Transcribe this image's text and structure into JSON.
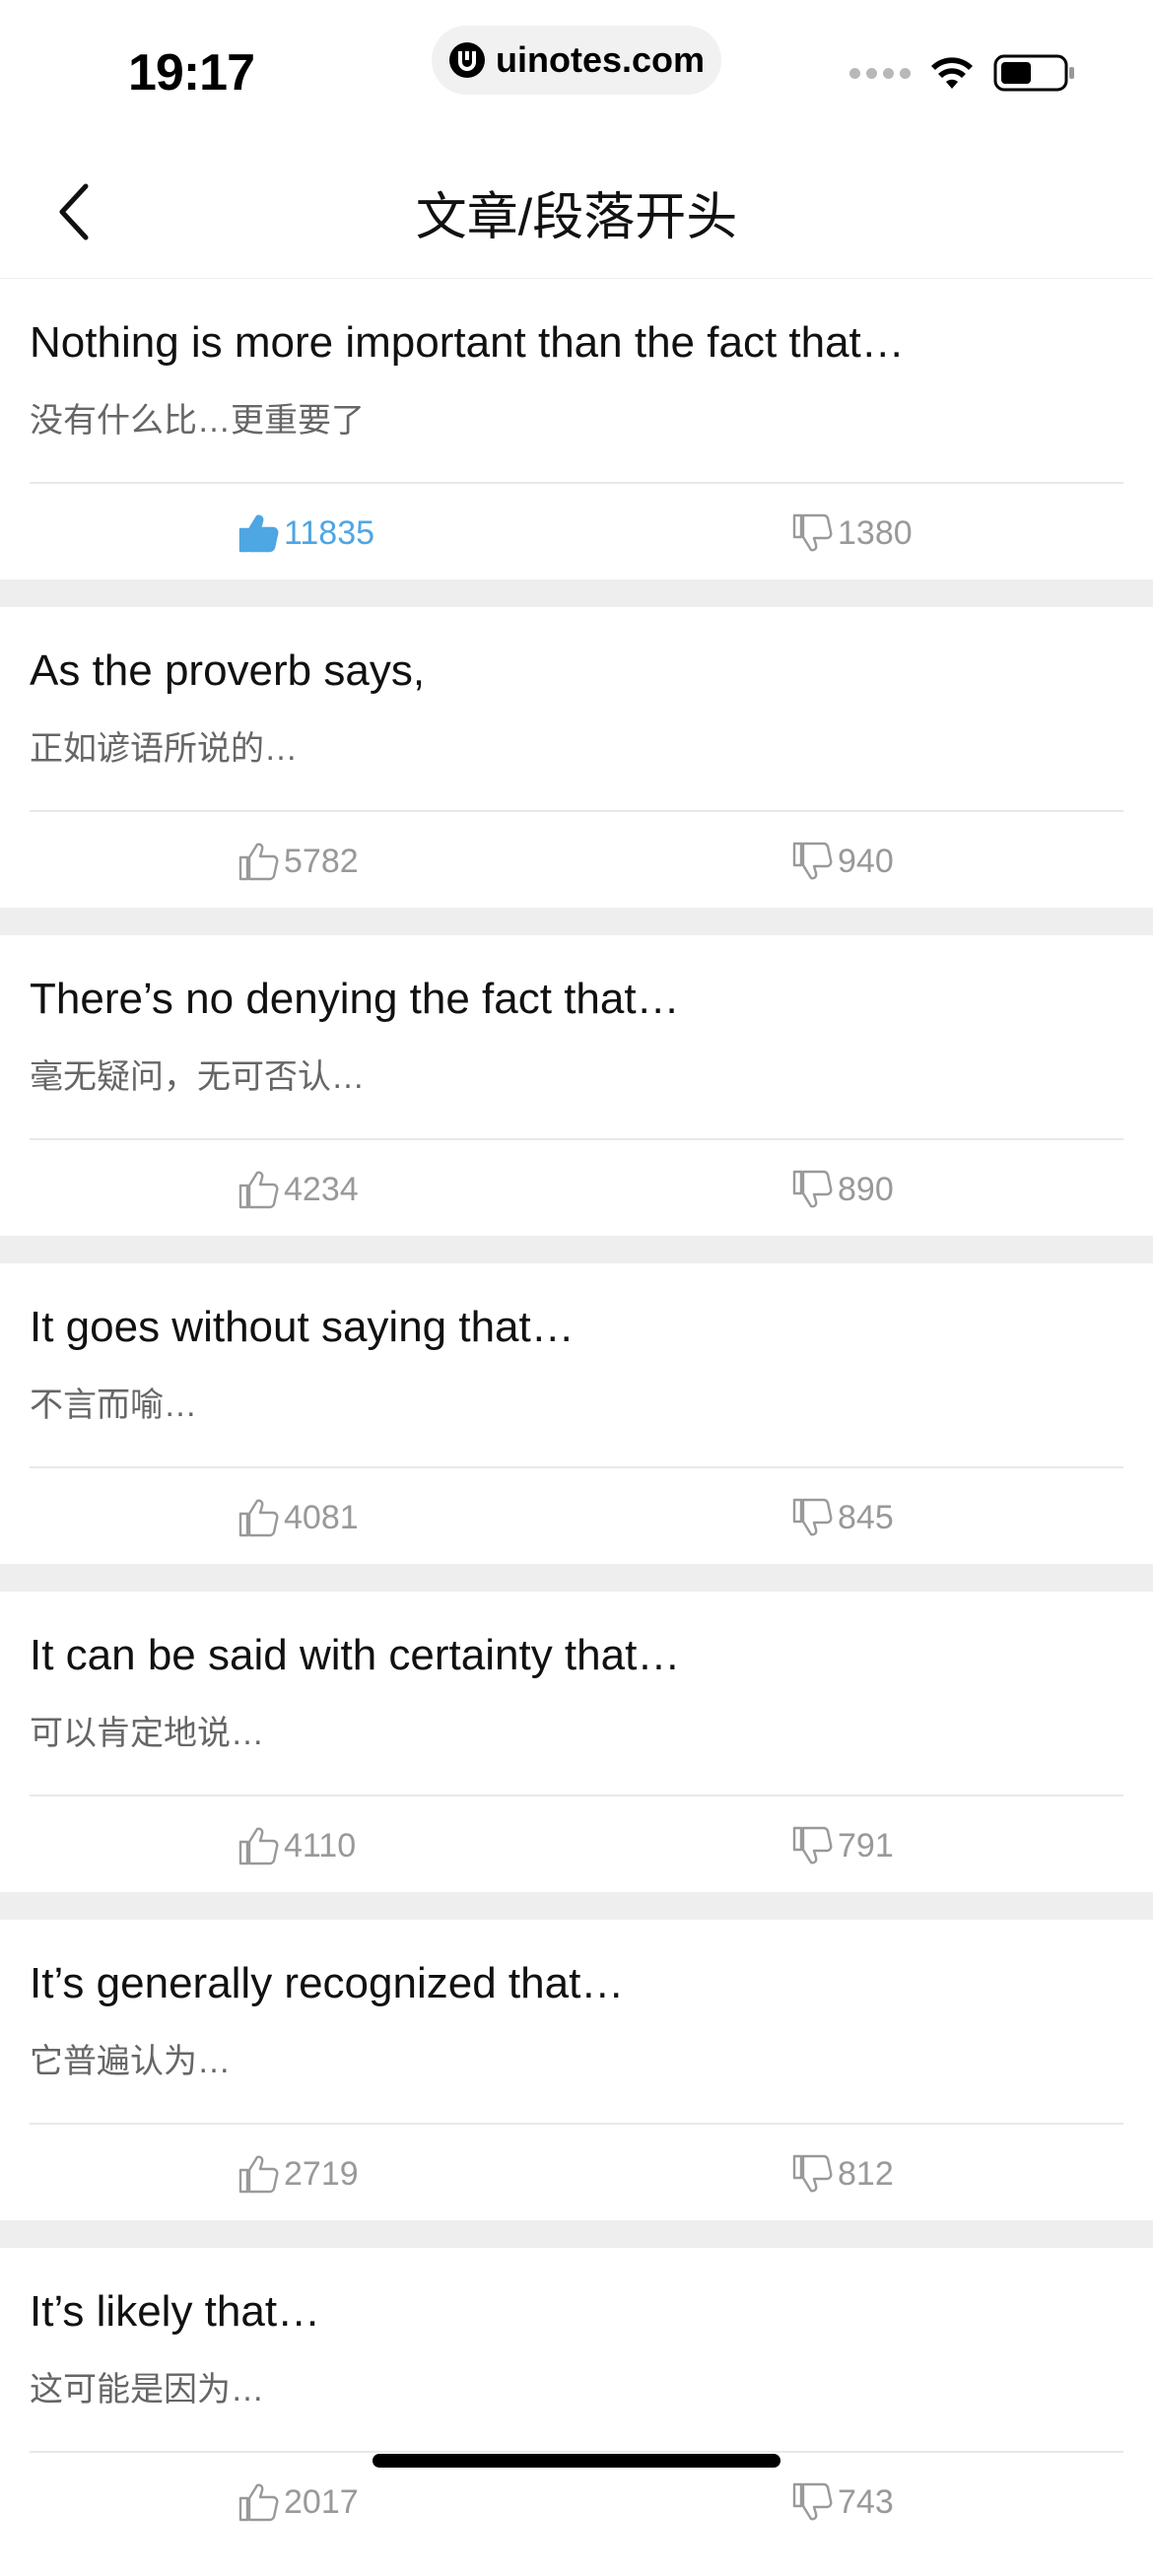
{
  "status_bar": {
    "time": "19:17",
    "url": "uinotes.com"
  },
  "nav": {
    "title": "文章/段落开头",
    "back_icon": "chevron-left-icon"
  },
  "icons": {
    "like": "thumbs-up-icon",
    "dislike": "thumbs-down-icon"
  },
  "colors": {
    "accent": "#4ea6e3",
    "muted": "#999999",
    "separator": "#eeeeee"
  },
  "items": [
    {
      "english": "Nothing is more important than the fact that…",
      "chinese": "没有什么比…更重要了",
      "likes": "11835",
      "dislikes": "1380",
      "liked": true
    },
    {
      "english": "As the proverb says,",
      "chinese": "正如谚语所说的…",
      "likes": "5782",
      "dislikes": "940",
      "liked": false
    },
    {
      "english": "There’s no denying the fact that…",
      "chinese": "毫无疑问，无可否认…",
      "likes": "4234",
      "dislikes": "890",
      "liked": false
    },
    {
      "english": "It goes without saying that…",
      "chinese": "不言而喻…",
      "likes": "4081",
      "dislikes": "845",
      "liked": false
    },
    {
      "english": "It can be said with certainty that…",
      "chinese": "可以肯定地说…",
      "likes": "4110",
      "dislikes": "791",
      "liked": false
    },
    {
      "english": "It’s generally recognized that…",
      "chinese": "它普遍认为…",
      "likes": "2719",
      "dislikes": "812",
      "liked": false
    },
    {
      "english": "It’s likely that…",
      "chinese": "这可能是因为…",
      "likes": "2017",
      "dislikes": "743",
      "liked": false
    }
  ]
}
